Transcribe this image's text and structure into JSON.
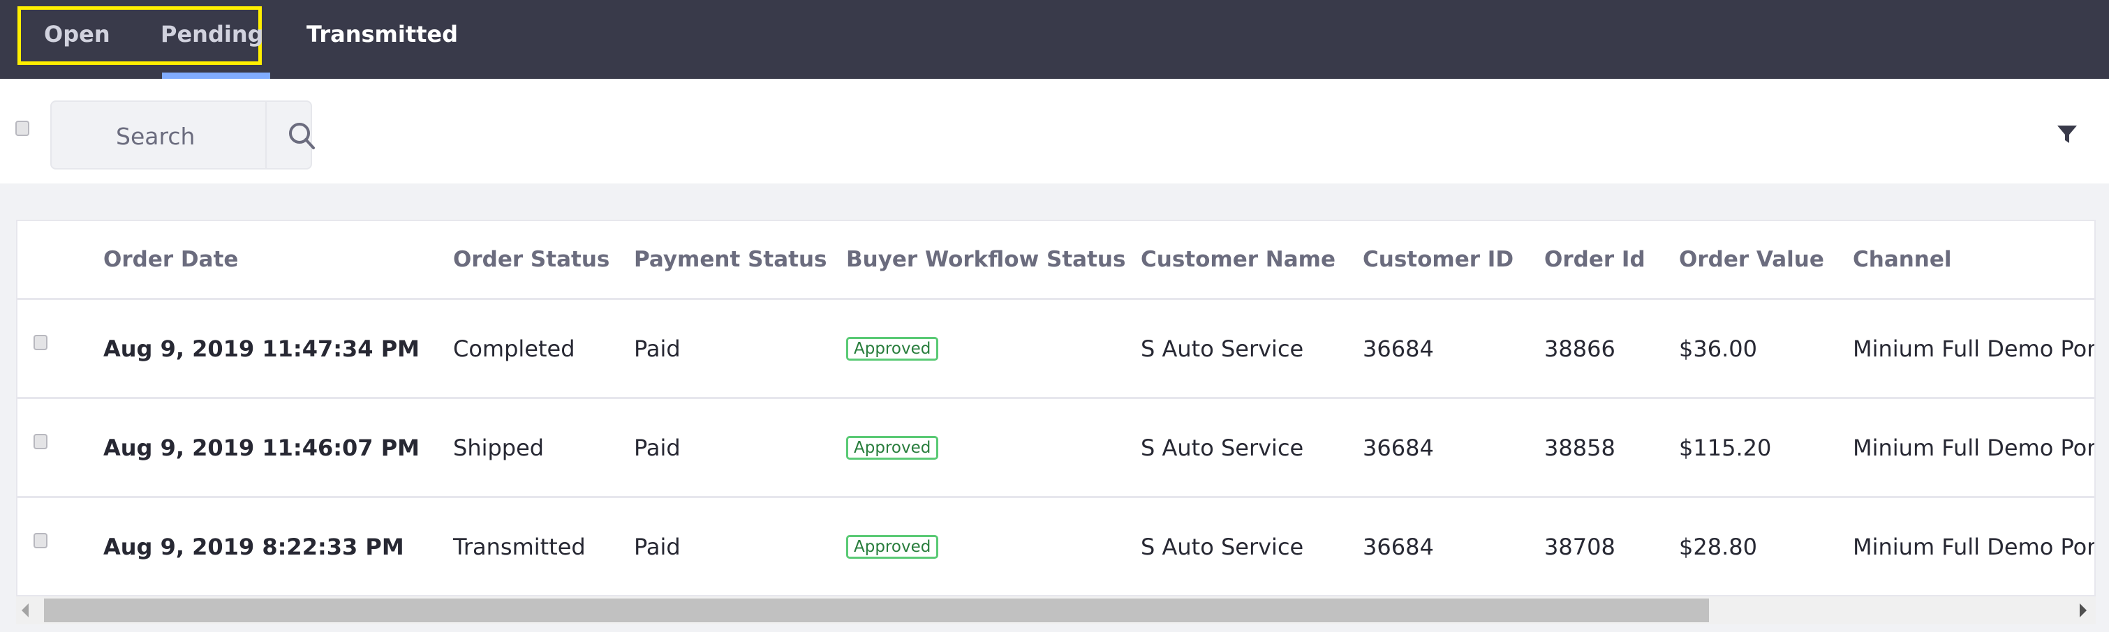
{
  "tabs": [
    {
      "label": "Open"
    },
    {
      "label": "Pending"
    },
    {
      "label": "Transmitted",
      "active": true
    }
  ],
  "search": {
    "placeholder": "Search"
  },
  "table": {
    "headers": [
      "Order Date",
      "Order Status",
      "Payment Status",
      "Buyer Workflow Status",
      "Customer Name",
      "Customer ID",
      "Order Id",
      "Order Value",
      "Channel"
    ],
    "rows": [
      [
        "Aug 9, 2019 11:47:34 PM",
        "Completed",
        "Paid",
        "Approved",
        "S Auto Service",
        "36684",
        "38866",
        "$36.00",
        "Minium Full Demo Port"
      ],
      [
        "Aug 9, 2019 11:46:07 PM",
        "Shipped",
        "Paid",
        "Approved",
        "S Auto Service",
        "36684",
        "38858",
        "$115.20",
        "Minium Full Demo Port"
      ],
      [
        "Aug 9, 2019 8:22:33 PM",
        "Transmitted",
        "Paid",
        "Approved",
        "S Auto Service",
        "36684",
        "38708",
        "$28.80",
        "Minium Full Demo Port"
      ]
    ]
  },
  "colors": {
    "topbar": "#393a4a",
    "active_tab_underline": "#80acff",
    "highlight_box": "#ffef00",
    "approved_border": "#5aca75",
    "approved_text": "#287d3c"
  }
}
